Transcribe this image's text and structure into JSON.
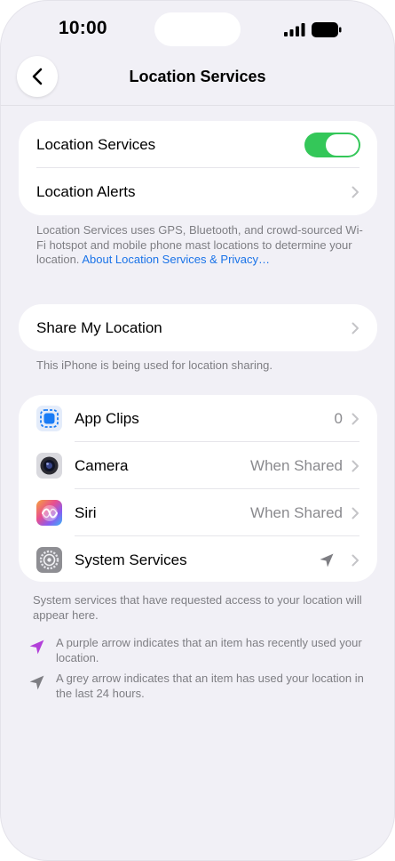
{
  "status_bar": {
    "time": "10:00"
  },
  "nav": {
    "title": "Location Services"
  },
  "section1": {
    "location_services_label": "Location Services",
    "location_services_on": true,
    "location_alerts_label": "Location Alerts",
    "footer_text": "Location Services uses GPS, Bluetooth, and crowd-sourced Wi-Fi hotspot and mobile phone mast locations to determine your location.",
    "footer_link": "About Location Services & Privacy…"
  },
  "section2": {
    "share_label": "Share My Location",
    "footer_text": "This iPhone is being used for location sharing."
  },
  "apps": [
    {
      "label": "App Clips",
      "value": "0",
      "icon": "app-clips-icon"
    },
    {
      "label": "Camera",
      "value": "When Shared",
      "icon": "camera-icon"
    },
    {
      "label": "Siri",
      "value": "When Shared",
      "icon": "siri-icon"
    },
    {
      "label": "System Services",
      "value": "",
      "icon": "settings-gear-icon"
    }
  ],
  "footer": {
    "system_text": "System services that have requested access to your location will appear here.",
    "purple_text": "A purple arrow indicates that an item has recently used your location.",
    "grey_text": "A grey arrow indicates that an item has used your location in the last 24 hours."
  },
  "colors": {
    "toggle_on": "#34c759",
    "link": "#1a73e8",
    "purple_arrow": "#b23fd9",
    "grey_arrow": "#7e7e83"
  }
}
